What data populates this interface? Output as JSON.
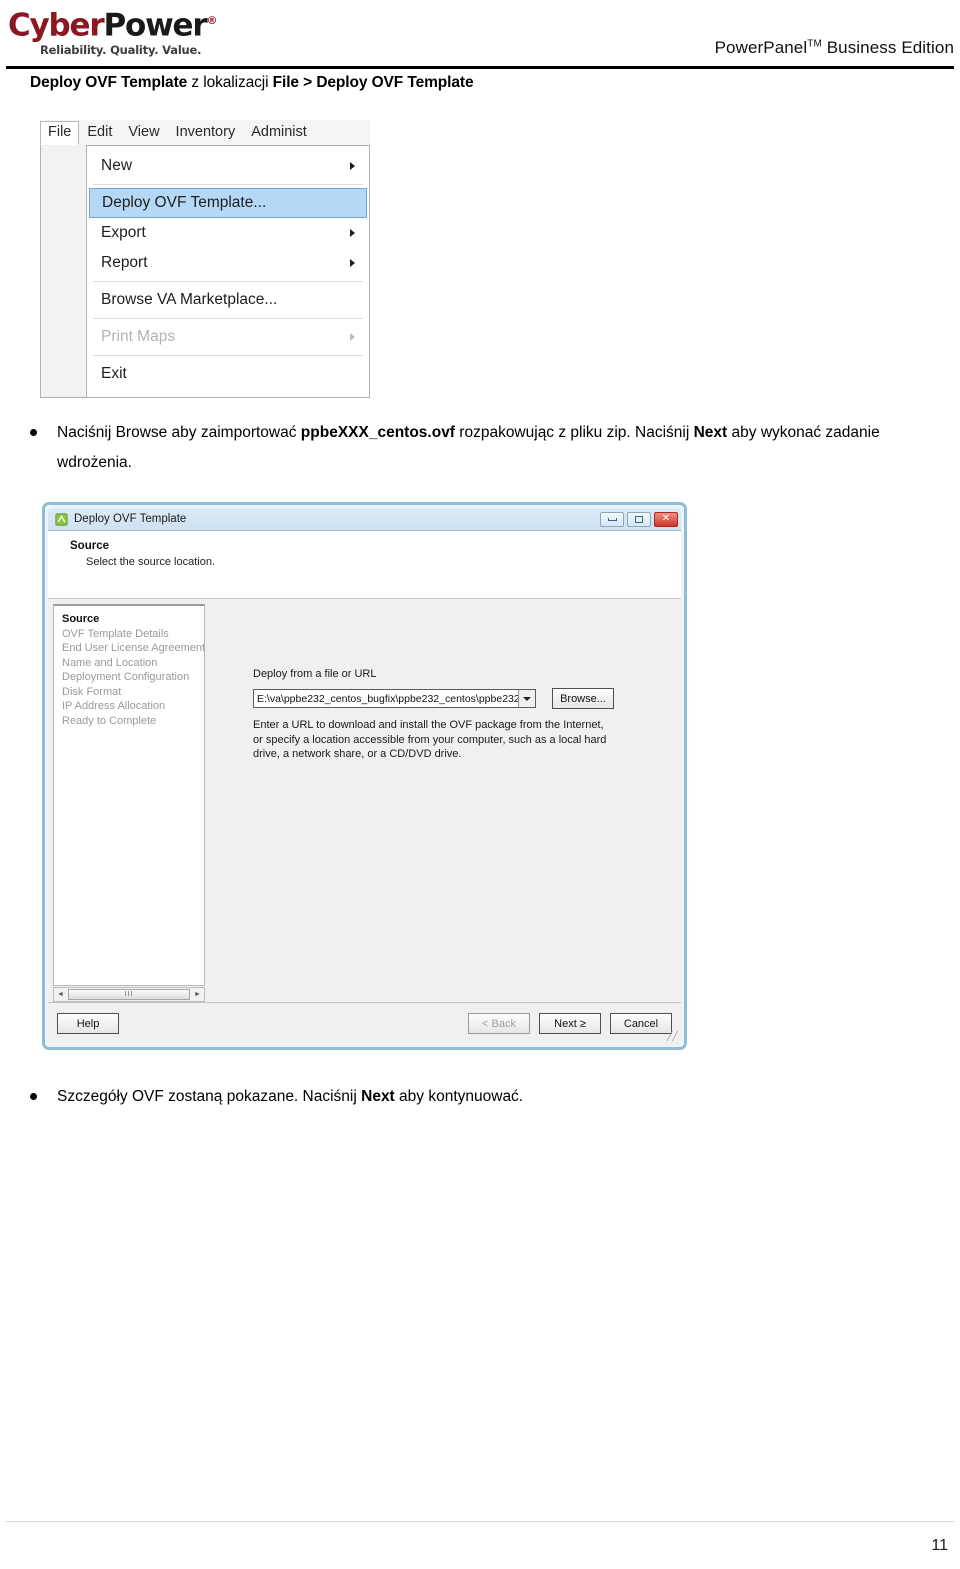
{
  "header": {
    "logo": {
      "cyber": "Cyber",
      "power": "Power",
      "registered": "®",
      "tagline": "Reliability. Quality. Value."
    },
    "product": "PowerPanel",
    "product_tm": "TM",
    "product_suffix": " Business Edition"
  },
  "section": {
    "title_bold_1": "Deploy OVF Template",
    "title_normal": " z lokalizacji ",
    "title_bold_2": "File > Deploy OVF Template"
  },
  "menu_screenshot": {
    "menubar": [
      {
        "label": "File",
        "active": true
      },
      {
        "label": "Edit",
        "active": false
      },
      {
        "label": "View",
        "active": false
      },
      {
        "label": "Inventory",
        "active": false
      },
      {
        "label": "Administ",
        "active": false
      }
    ],
    "items": [
      {
        "label": "New",
        "submenu": true,
        "disabled": false,
        "highlight": false,
        "separator_after": true
      },
      {
        "label": "Deploy OVF Template...",
        "submenu": false,
        "disabled": false,
        "highlight": true,
        "separator_after": false
      },
      {
        "label": "Export",
        "submenu": true,
        "disabled": false,
        "highlight": false,
        "separator_after": false
      },
      {
        "label": "Report",
        "submenu": true,
        "disabled": false,
        "highlight": false,
        "separator_after": true
      },
      {
        "label": "Browse VA Marketplace...",
        "submenu": false,
        "disabled": false,
        "highlight": false,
        "separator_after": true
      },
      {
        "label": "Print Maps",
        "submenu": true,
        "disabled": true,
        "highlight": false,
        "separator_after": true
      },
      {
        "label": "Exit",
        "submenu": false,
        "disabled": false,
        "highlight": false,
        "separator_after": false
      }
    ]
  },
  "bullet_1": {
    "part_1": "Naciśnij Browse aby zaimportować ",
    "bold_1": "ppbeXXX_centos.ovf",
    "part_2": " rozpakowując z pliku zip. Naciśnij ",
    "bold_2": "Next",
    "part_3": " aby wykonać zadanie wdrożenia."
  },
  "bullet_2": {
    "part_1": "Szczegóły OVF zostaną pokazane. Naciśnij ",
    "bold_1": "Next",
    "part_2": " aby kontynuować."
  },
  "dialog": {
    "title": "Deploy OVF Template",
    "window_buttons": {
      "minimize": "minimize",
      "maximize": "maximize",
      "close": "✕"
    },
    "heading": "Source",
    "subheading": "Select the source location.",
    "steps": [
      {
        "label": "Source",
        "current": true
      },
      {
        "label": "OVF Template Details",
        "current": false
      },
      {
        "label": "End User License Agreement",
        "current": false
      },
      {
        "label": "Name and Location",
        "current": false
      },
      {
        "label": "Deployment Configuration",
        "current": false
      },
      {
        "label": "Disk Format",
        "current": false
      },
      {
        "label": "IP Address Allocation",
        "current": false
      },
      {
        "label": "Ready to Complete",
        "current": false
      }
    ],
    "steps_scrollbar": {
      "left_arrow": "◄",
      "right_arrow": "►",
      "thumb_grip": "III"
    },
    "field_label": "Deploy from a file or URL",
    "field_value": "E:\\va\\ppbe232_centos_bugfix\\ppbe232_centos\\ppbe232_",
    "browse_button": "Browse...",
    "helper_text": "Enter a URL to download and install the OVF package from the Internet, or specify a location accessible from your computer, such as a local hard drive, a network share, or a CD/DVD drive.",
    "help_button": "Help",
    "back_button": "< Back",
    "next_button": "Next ≥",
    "cancel_button": "Cancel",
    "resize_grip": "╱╱"
  },
  "footer": {
    "page_number": "11"
  },
  "colors": {
    "brand_red": "#8c1622",
    "menu_highlight_fill": "#b4d8f5",
    "menu_highlight_border": "#6fa8d8",
    "dialog_border": "#8fbcd9",
    "titlebar_top": "#dceaf6",
    "close_button": "#c8372a"
  }
}
